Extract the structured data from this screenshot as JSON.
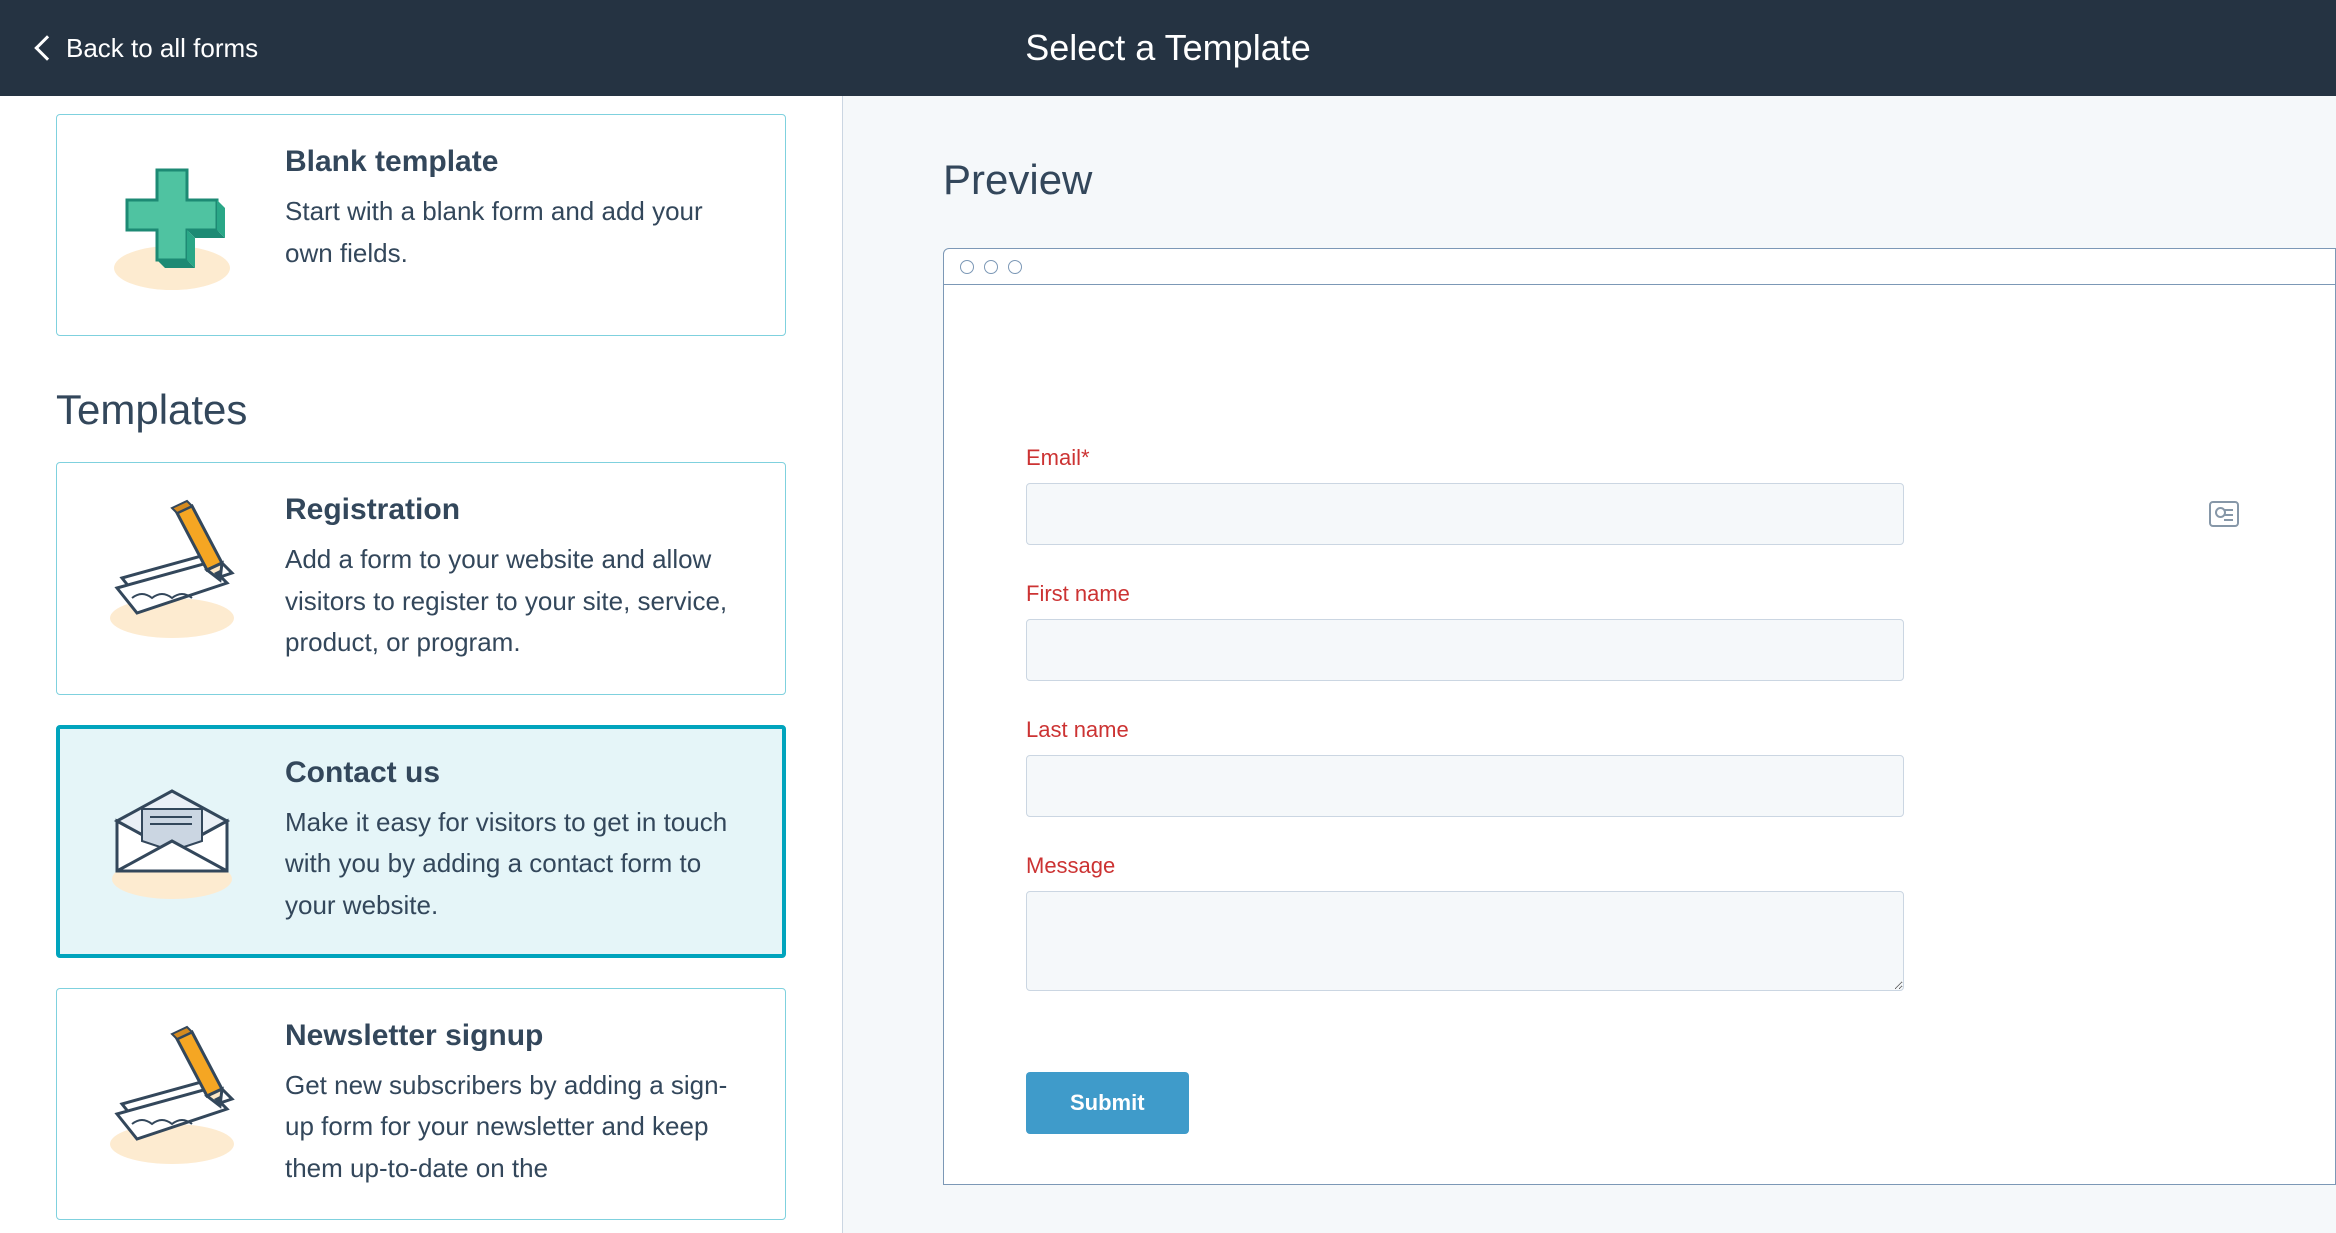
{
  "header": {
    "back_label": "Back to all forms",
    "title": "Select a Template"
  },
  "sidebar": {
    "blank": {
      "title": "Blank template",
      "desc": "Start with a blank form and add your own fields."
    },
    "section_heading": "Templates",
    "templates": [
      {
        "id": "registration",
        "title": "Registration",
        "desc": "Add a form to your website and allow visitors to register to your site, service, product, or program.",
        "selected": false,
        "icon": "pencil-paper"
      },
      {
        "id": "contact-us",
        "title": "Contact us",
        "desc": "Make it easy for visitors to get in touch with you by adding a contact form to your website.",
        "selected": true,
        "icon": "envelope"
      },
      {
        "id": "newsletter-signup",
        "title": "Newsletter signup",
        "desc": "Get new subscribers by adding a sign-up form for your newsletter and keep them up-to-date on the",
        "selected": false,
        "icon": "pencil-paper"
      }
    ]
  },
  "preview": {
    "heading": "Preview",
    "form": {
      "fields": [
        {
          "label": "Email*",
          "type": "text",
          "badge": true
        },
        {
          "label": "First name",
          "type": "text",
          "badge": false
        },
        {
          "label": "Last name",
          "type": "text",
          "badge": false
        },
        {
          "label": "Message",
          "type": "textarea",
          "badge": false
        }
      ],
      "submit_label": "Submit"
    }
  }
}
